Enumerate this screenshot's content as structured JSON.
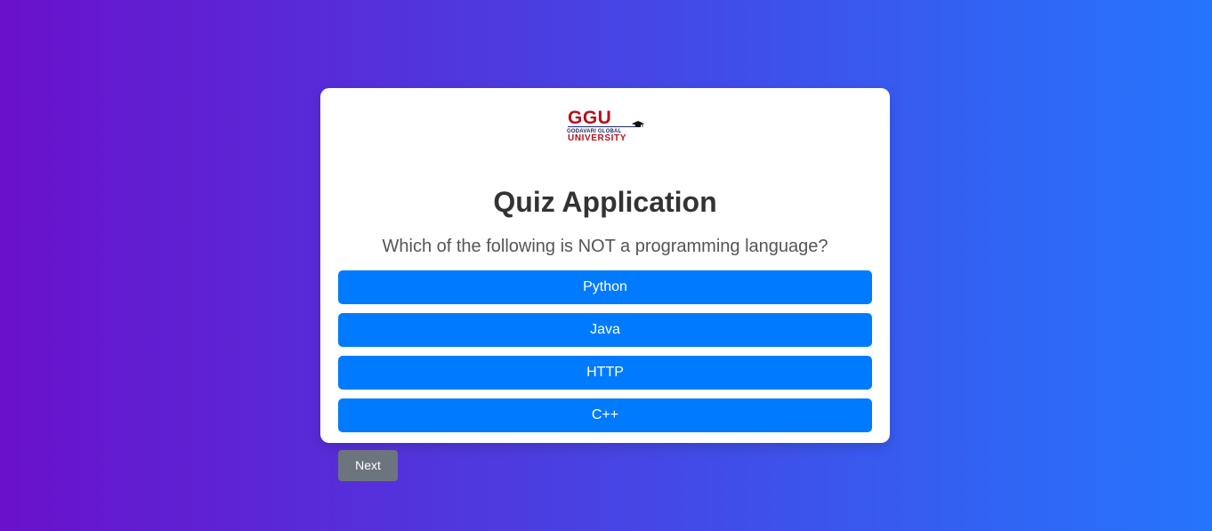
{
  "logo": {
    "name": "GGU",
    "line1": "GODAVARI GLOBAL",
    "line2": "UNIVERSITY",
    "icon": "graduation-cap-icon",
    "colors": {
      "red": "#b5121b",
      "navy": "#1d2a6b"
    }
  },
  "quiz": {
    "title": "Quiz Application",
    "question": "Which of the following is NOT a programming language?",
    "answers": [
      {
        "label": "Python"
      },
      {
        "label": "Java"
      },
      {
        "label": "HTTP"
      },
      {
        "label": "C++"
      }
    ],
    "next_label": "Next"
  },
  "colors": {
    "background_gradient_start": "#6a11cb",
    "background_gradient_end": "#2575fc",
    "answer_button": "#007bff",
    "next_button": "#6c757d",
    "card": "#ffffff"
  }
}
